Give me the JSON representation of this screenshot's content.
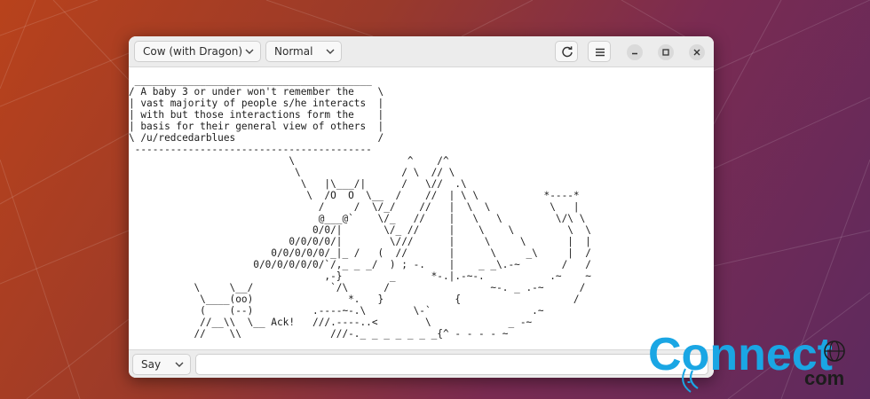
{
  "window": {
    "cow_select": "Cow (with Dragon)",
    "style_select": "Normal",
    "refresh_icon": "refresh-icon",
    "menu_icon": "hamburger-menu-icon"
  },
  "cow_output": " ________________________________________\n/ A baby 3 or under won't remember the    \\\n| vast majority of people s/he interacts  |\n| with but those interactions form the    |\n| basis for their general view of others  |\n\\ /u/redcedarblues                        /\n ----------------------------------------\n                           \\                   ^    /^\n                            \\                 / \\  // \\\n                             \\   |\\___/|      /   \\//  .\\\n                              \\  /O  O  \\__  /    //  | \\ \\           *----*\n                                /     /  \\/_/    //   |  \\  \\          \\   |\n                                @___@`    \\/_   //    |   \\   \\         \\/\\ \\\n                               0/0/|       \\/_ //     |    \\    \\         \\  \\\n                           0/0/0/0/|        \\///      |     \\     \\       |  |\n                        0/0/0/0/0/_|_ /   (  //       |      \\     _\\     |  /\n                     0/0/0/0/0/0/`/,_ _ _/  ) ; -.    |    _ _\\.-~       /   /\n                                 ,-}        _      *-.|.-~-.           .~    ~\n           \\     \\__/             `/\\      /                 ~-. _ .-~      /\n            \\____(oo)                *.   }            {                   /\n            (    (--)          .----~-.\\        \\-`                 .~\n            //__\\\\  \\__ Ack!   ///.----..<        \\             _ -~\n           //    \\\\               ///-._ _ _ _ _ _ _{^ - - - - ~",
  "footer": {
    "mode_select": "Say",
    "message_value": ""
  },
  "watermark": {
    "brand": "Connect",
    "brand_sub": "com",
    "brand_color": "#1aa6e4"
  }
}
